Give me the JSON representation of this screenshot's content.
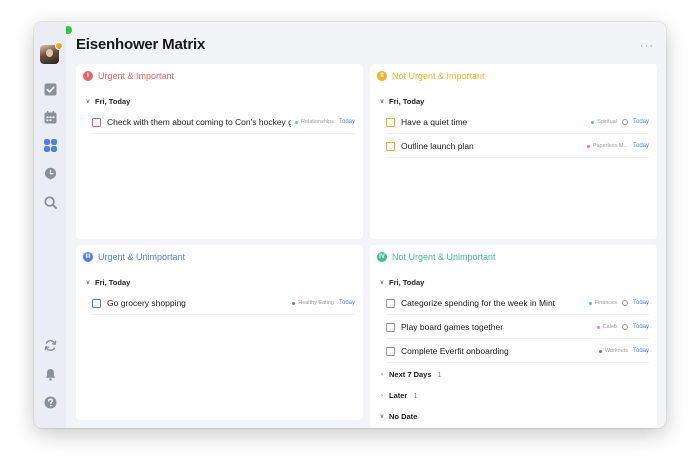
{
  "window": {
    "title": "Eisenhower Matrix",
    "more": "···"
  },
  "colors": {
    "urgent_important": "#e06666",
    "not_urgent_important": "#f0b429",
    "urgent_unimportant": "#4f7ee8",
    "not_urgent_unimportant": "#3fbf8f",
    "due": "#4f7ee8"
  },
  "sidebar": {
    "items": [
      {
        "name": "avatar",
        "icon": "avatar"
      },
      {
        "name": "tasks",
        "icon": "checkbox-icon"
      },
      {
        "name": "calendar",
        "icon": "calendar-icon"
      },
      {
        "name": "matrix",
        "icon": "matrix-icon",
        "active": true
      },
      {
        "name": "habit",
        "icon": "pomodoro-icon"
      },
      {
        "name": "search",
        "icon": "search-icon"
      },
      {
        "name": "sync",
        "icon": "sync-icon"
      },
      {
        "name": "notifications",
        "icon": "bell-icon"
      },
      {
        "name": "help",
        "icon": "help-icon"
      }
    ]
  },
  "quadrants": [
    {
      "numeral": "I",
      "title": "Urgent & Important",
      "groups": [
        {
          "label": "Fri, Today",
          "expanded": true,
          "tasks": [
            {
              "title": "Check with them about coming to Con's hockey game",
              "tag": "Relationships",
              "tag_color": "#5bc0be",
              "due": "Today",
              "repeat": false
            }
          ]
        }
      ]
    },
    {
      "numeral": "II",
      "title": "Not Urgent & Important",
      "groups": [
        {
          "label": "Fri, Today",
          "expanded": true,
          "tasks": [
            {
              "title": "Have a quiet time",
              "tag": "Spiritual",
              "tag_color": "#5bc0be",
              "due": "Today",
              "repeat": true
            },
            {
              "title": "Outline launch plan",
              "tag": "Paperless M...",
              "tag_color": "#e57a9c",
              "due": "Today",
              "repeat": false
            }
          ]
        }
      ]
    },
    {
      "numeral": "III",
      "title": "Urgent & Unimportant",
      "groups": [
        {
          "label": "Fri, Today",
          "expanded": true,
          "tasks": [
            {
              "title": "Go grocery shopping",
              "tag": "Healthy Eating",
              "tag_color": "#4f7ee8",
              "due": "Today",
              "repeat": false
            }
          ]
        }
      ]
    },
    {
      "numeral": "IV",
      "title": "Not Urgent & Unimportant",
      "groups": [
        {
          "label": "Fri, Today",
          "expanded": true,
          "tasks": [
            {
              "title": "Categorize spending for the week in Mint",
              "tag": "Finances",
              "tag_color": "#5bc0be",
              "due": "Today",
              "repeat": true
            },
            {
              "title": "Play board games together",
              "tag": "Caleb",
              "tag_color": "#d98ad9",
              "due": "Today",
              "repeat": true
            },
            {
              "title": "Complete Everfit onboarding",
              "tag": "Workouts",
              "tag_color": "#4f7ee8",
              "due": "Today",
              "repeat": false
            }
          ]
        },
        {
          "label": "Next 7 Days",
          "count": "1",
          "expanded": false,
          "tasks": []
        },
        {
          "label": "Later",
          "count": "1",
          "expanded": false,
          "tasks": []
        },
        {
          "label": "No Date",
          "expanded": true,
          "tasks": []
        }
      ]
    }
  ]
}
